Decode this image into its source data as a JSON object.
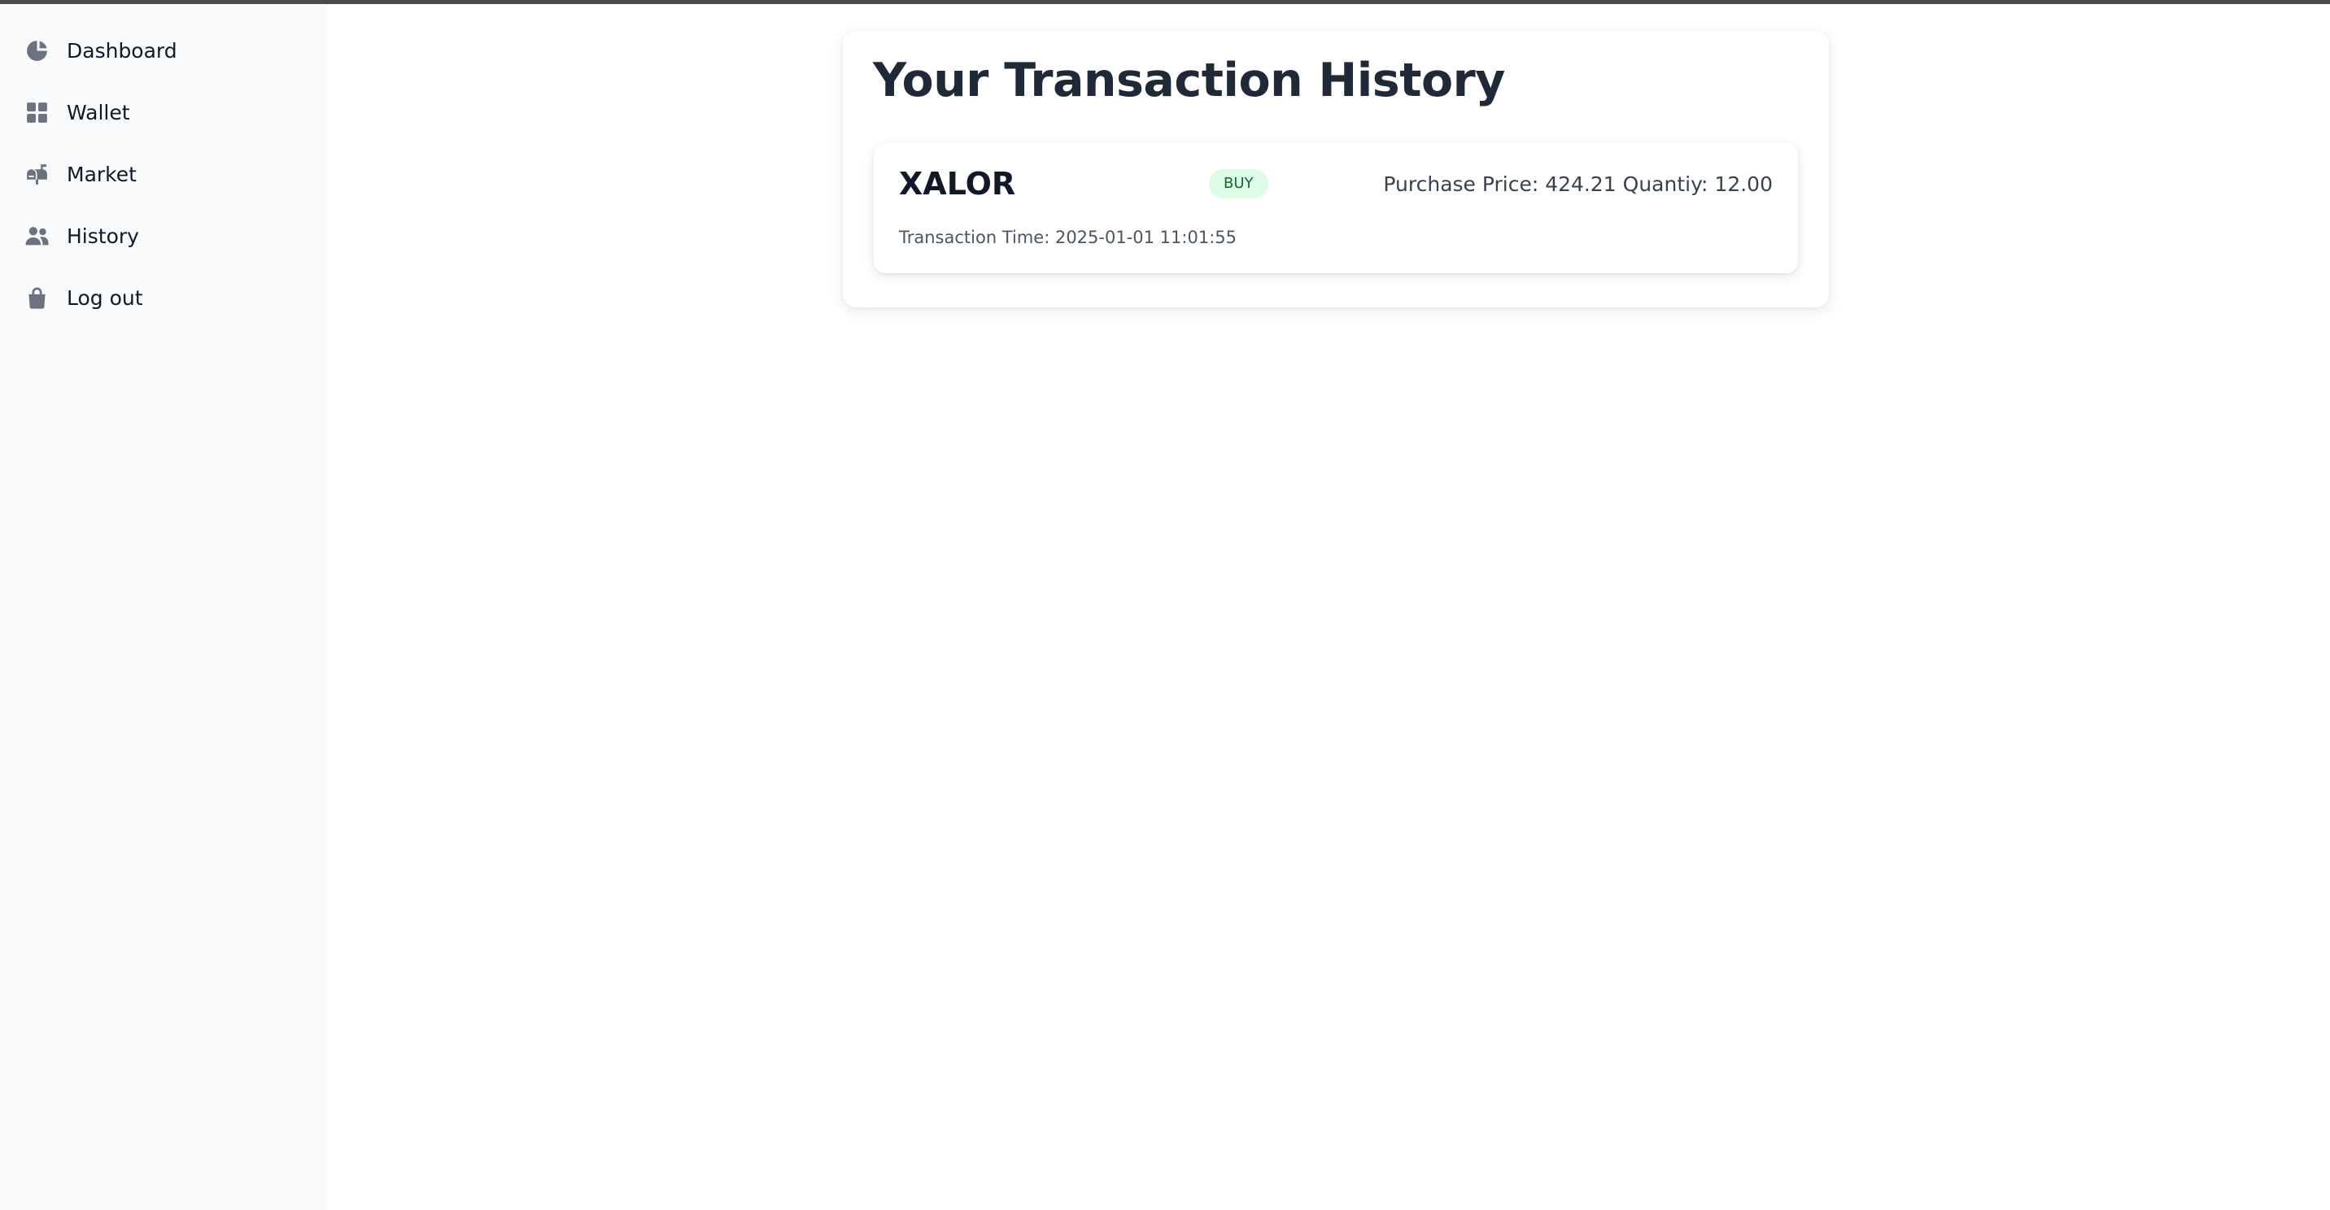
{
  "sidebar": {
    "items": [
      {
        "label": "Dashboard",
        "icon": "pie-chart-icon"
      },
      {
        "label": "Wallet",
        "icon": "grid-icon"
      },
      {
        "label": "Market",
        "icon": "mailbox-icon"
      },
      {
        "label": "History",
        "icon": "users-icon"
      },
      {
        "label": "Log out",
        "icon": "shopping-bag-icon"
      }
    ]
  },
  "main": {
    "title": "Your Transaction History",
    "transactions": [
      {
        "symbol": "XALOR",
        "type": "BUY",
        "details": "Purchase Price: 424.21 Quantiy: 12.00",
        "time": "Transaction Time: 2025-01-01 11:01:55"
      }
    ]
  },
  "colors": {
    "sidebar_bg": "#f9fafb",
    "icon": "#6b7280",
    "badge_bg": "#dcfce7",
    "badge_text": "#166534",
    "title": "#1f2937"
  }
}
